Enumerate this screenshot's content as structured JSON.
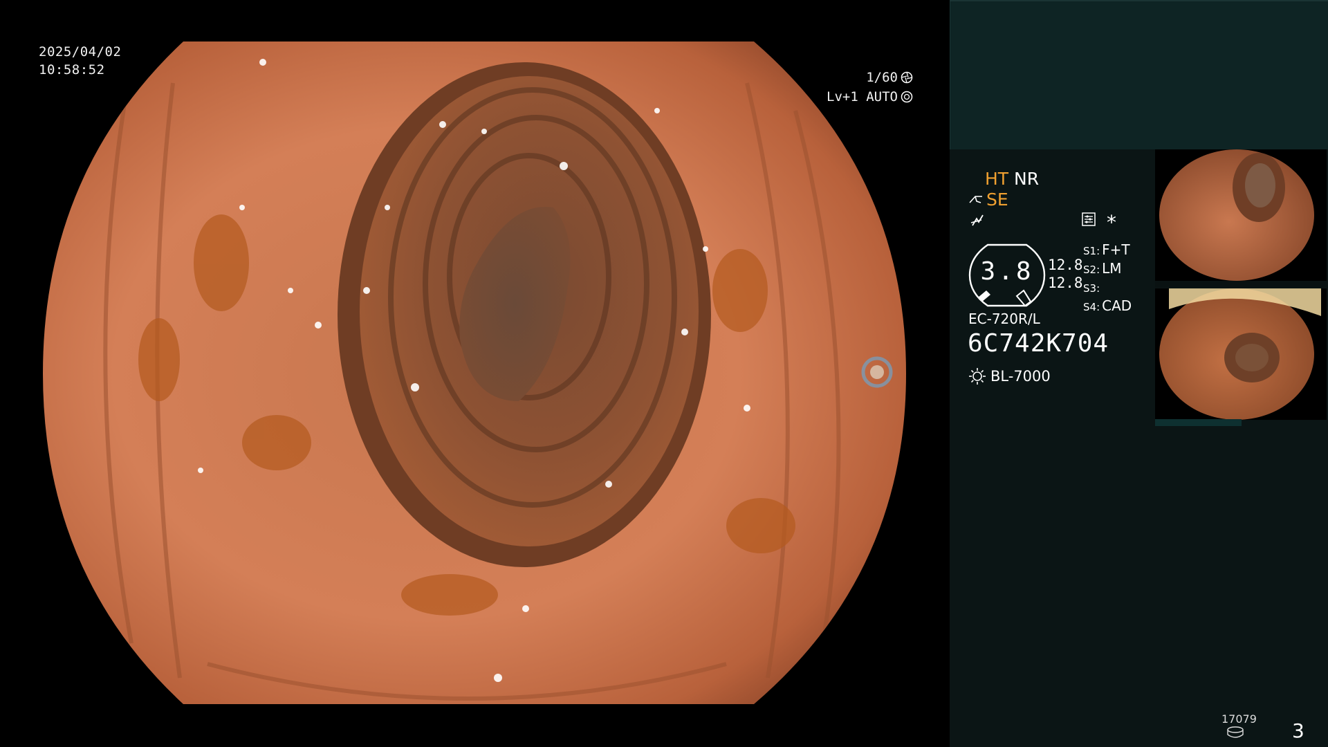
{
  "date": "2025/04/02",
  "time": "10:58:52",
  "shutter": "1/60",
  "iris": "Lv+1 AUTO",
  "modes": {
    "ht": "HT",
    "nr": "NR",
    "se": "SE"
  },
  "zoom": "3.8",
  "magnification": [
    "12.8",
    "12.8"
  ],
  "switches": [
    {
      "label": "S1:",
      "value": "F+T"
    },
    {
      "label": "S2:",
      "value": "LM"
    },
    {
      "label": "S3:",
      "value": ""
    },
    {
      "label": "S4:",
      "value": "CAD"
    }
  ],
  "scope_model": "EC-720R/L",
  "serial": "6C742K704",
  "light_source": "BL-7000",
  "image_counter": "17079",
  "page_number": "3",
  "colors": {
    "accent": "#f0a030",
    "panel": "#0b1515",
    "panel_top": "#0e2424"
  },
  "icons": [
    "shutter-icon",
    "iris-icon",
    "scope-tip-icon",
    "flash-icon",
    "settings-icon",
    "lamp-icon",
    "database-icon"
  ]
}
